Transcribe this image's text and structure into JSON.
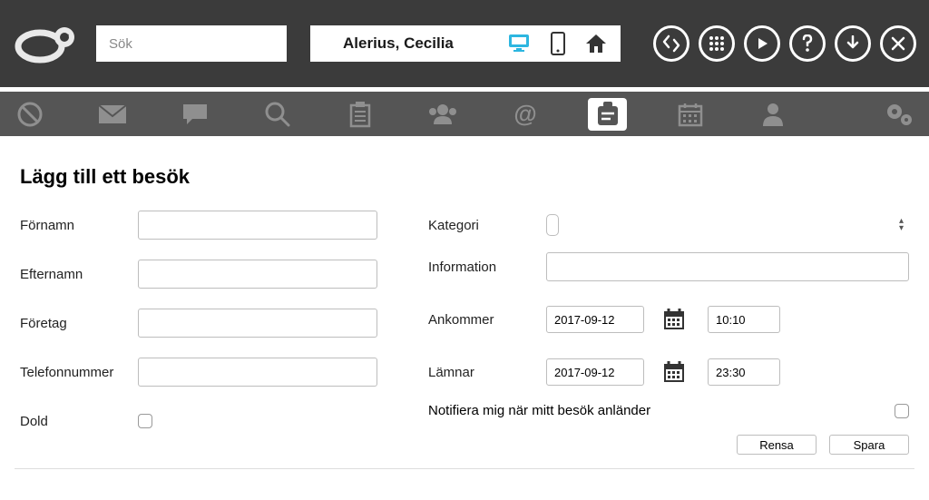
{
  "header": {
    "search_placeholder": "Sök",
    "user_name": "Alerius, Cecilia"
  },
  "page": {
    "title": "Lägg till ett besök",
    "labels": {
      "fornamn": "Förnamn",
      "efternamn": "Efternamn",
      "foretag": "Företag",
      "telefonnummer": "Telefonnummer",
      "dold": "Dold",
      "kategori": "Kategori",
      "information": "Information",
      "ankommer": "Ankommer",
      "lamnar": "Lämnar",
      "notifiera": "Notifiera mig när mitt besök anländer"
    },
    "values": {
      "fornamn": "",
      "efternamn": "",
      "foretag": "",
      "telefonnummer": "",
      "dold": false,
      "kategori": "",
      "kategori_options": [],
      "information": "",
      "ankommer_date": "2017-09-12",
      "ankommer_time": "10:10",
      "lamnar_date": "2017-09-12",
      "lamnar_time": "23:30",
      "notifiera": false
    },
    "buttons": {
      "rensa": "Rensa",
      "spara": "Spara"
    }
  },
  "colors": {
    "header_bg": "#3b3b3b",
    "nav_bg": "#555555",
    "accent": "#2db6e0"
  }
}
